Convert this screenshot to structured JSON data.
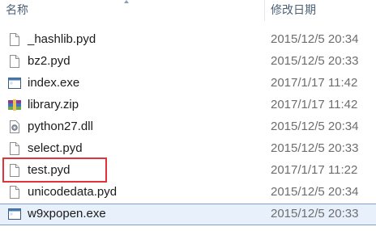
{
  "header": {
    "name_label": "名称",
    "date_label": "修改日期"
  },
  "files": [
    {
      "name": "_hashlib.pyd",
      "date": "2015/12/5 20:34",
      "icon": "document-icon"
    },
    {
      "name": "bz2.pyd",
      "date": "2015/12/5 20:33",
      "icon": "document-icon"
    },
    {
      "name": "index.exe",
      "date": "2017/1/17 11:42",
      "icon": "exe-window-icon"
    },
    {
      "name": "library.zip",
      "date": "2017/1/17 11:42",
      "icon": "zip-archive-icon"
    },
    {
      "name": "python27.dll",
      "date": "2015/12/5 20:34",
      "icon": "dll-gear-icon"
    },
    {
      "name": "select.pyd",
      "date": "2015/12/5 20:33",
      "icon": "document-icon"
    },
    {
      "name": "test.pyd",
      "date": "2017/1/17 11:22",
      "icon": "document-icon"
    },
    {
      "name": "unicodedata.pyd",
      "date": "2015/12/5 20:34",
      "icon": "document-icon"
    },
    {
      "name": "w9xpopen.exe",
      "date": "2015/12/5 20:33",
      "icon": "exe-window-icon",
      "selected": true
    }
  ],
  "colors": {
    "highlight": "#e0333a",
    "selection": "#e8f1fb",
    "header_text": "#4c607a"
  }
}
